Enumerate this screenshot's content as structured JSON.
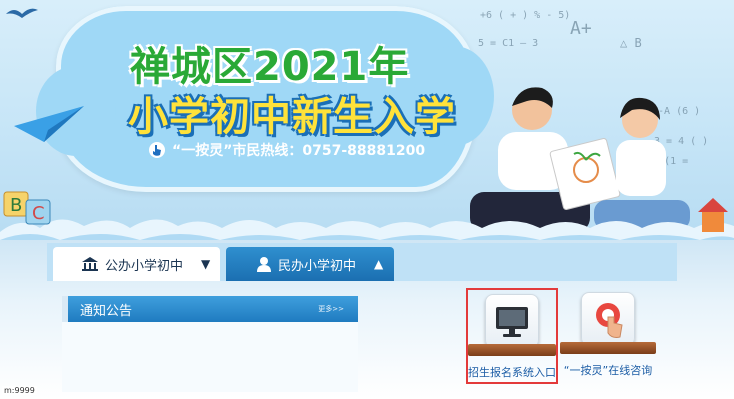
{
  "banner": {
    "title_line1": "禅城区2021年",
    "title_line2": "小学初中新生入学",
    "hotline": "“一按灵”市民热线：0757-88881200",
    "colors": {
      "title1": "#2aa936",
      "title2": "#ffe23a",
      "cloud": "#9fd8f6"
    }
  },
  "tabs": [
    {
      "label": "公办小学初中",
      "icon": "building-icon",
      "arrow": "▼",
      "active": true
    },
    {
      "label": "民办小学初中",
      "icon": "person-icon",
      "arrow": "▲",
      "active": false
    }
  ],
  "notice": {
    "title": "通知公告",
    "more": "更多>>"
  },
  "entries": [
    {
      "label": "招生报名系统入口",
      "icon": "computer-monitor-icon",
      "highlighted": true
    },
    {
      "label": "“一按灵”在线咨询",
      "icon": "finger-press-button-icon",
      "highlighted": false
    }
  ],
  "status_bar": {
    "text": "m:9999"
  }
}
